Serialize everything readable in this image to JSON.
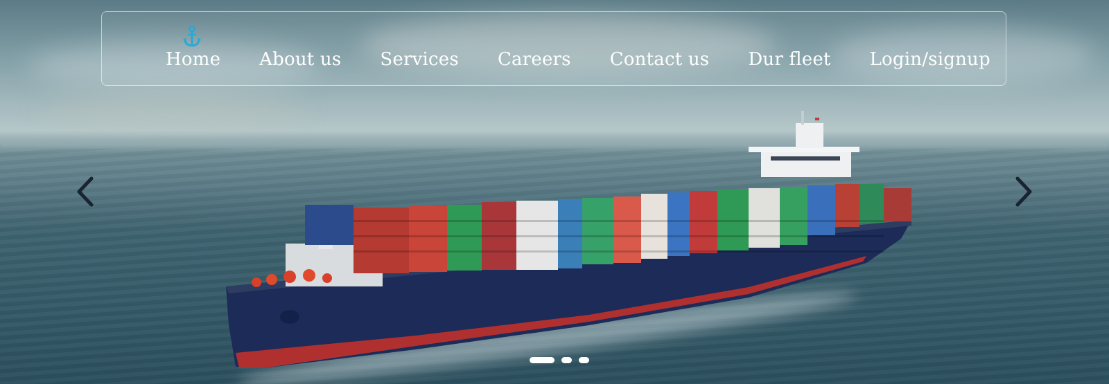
{
  "nav": {
    "logo_icon": "anchor-icon",
    "accent_color": "#29a9d6",
    "items": [
      {
        "label": "Home"
      },
      {
        "label": "About us"
      },
      {
        "label": "Services"
      },
      {
        "label": "Careers"
      },
      {
        "label": "Contact us"
      },
      {
        "label": "Dur fleet"
      },
      {
        "label": "Login/signup"
      }
    ]
  },
  "carousel": {
    "prev_icon": "chevron-left-icon",
    "next_icon": "chevron-right-icon",
    "slide_count": 3,
    "active_slide": 1,
    "image": "container-ship-at-sea"
  }
}
